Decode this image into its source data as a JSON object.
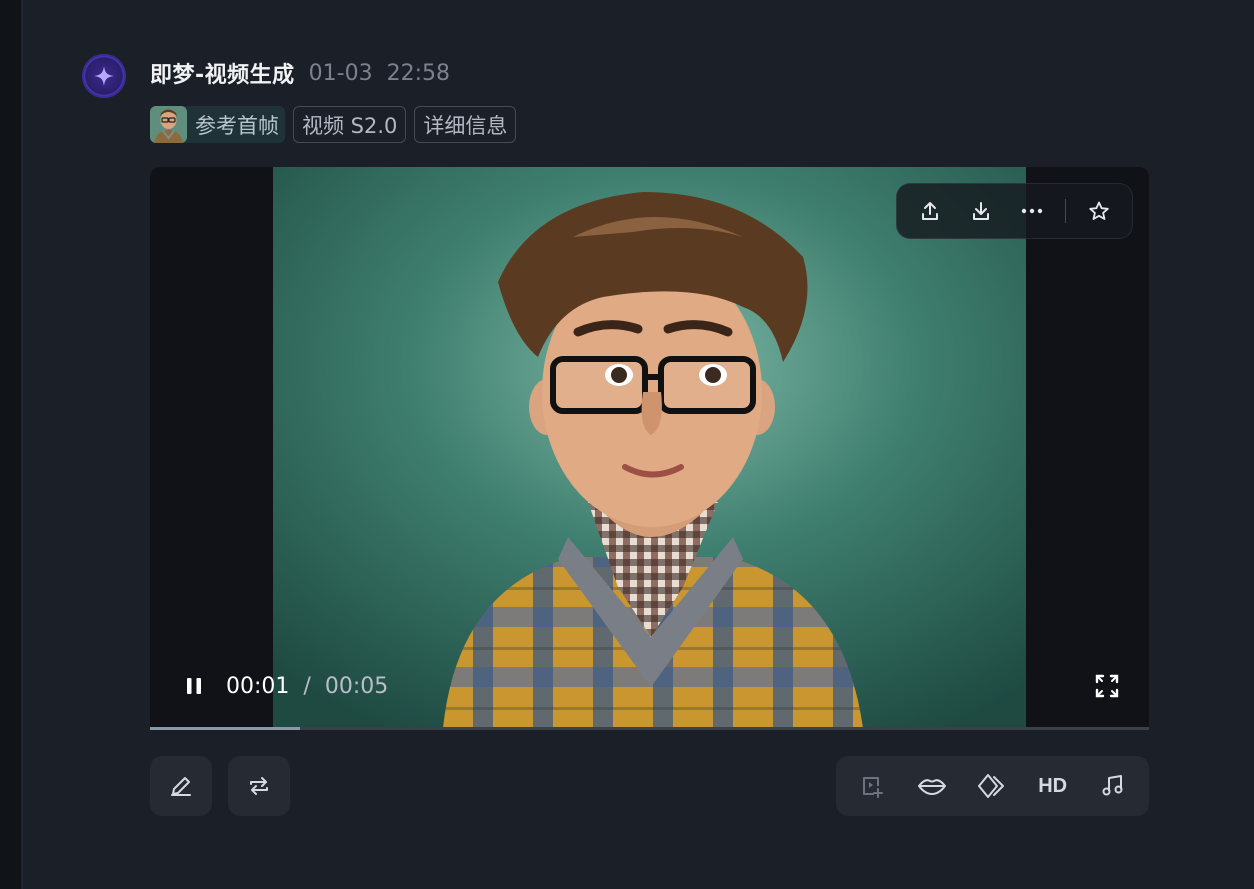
{
  "message": {
    "sender": "即梦-视频生成",
    "date": "01-03",
    "time": "22:58"
  },
  "tags": {
    "reference_frame": "参考首帧",
    "model": "视频 S2.0",
    "details": "详细信息"
  },
  "player": {
    "current_time": "00:01",
    "separator": "/",
    "duration": "00:05",
    "progress_fraction": 0.15,
    "state": "playing"
  },
  "top_toolbar": {
    "icons": [
      "share-icon",
      "download-icon",
      "more-icon",
      "star-icon"
    ]
  },
  "bottom_left_toolbar": {
    "icons": [
      "edit-icon",
      "regenerate-icon"
    ]
  },
  "bottom_right_toolbar": {
    "icons": [
      "frame-add-icon",
      "lip-sync-icon",
      "interpolate-icon",
      "hd-label",
      "music-icon"
    ],
    "hd_label": "HD"
  },
  "colors": {
    "panel": "#1b1f27",
    "accent": "#5b44d6",
    "scene_bg": "#2f6a5e"
  }
}
